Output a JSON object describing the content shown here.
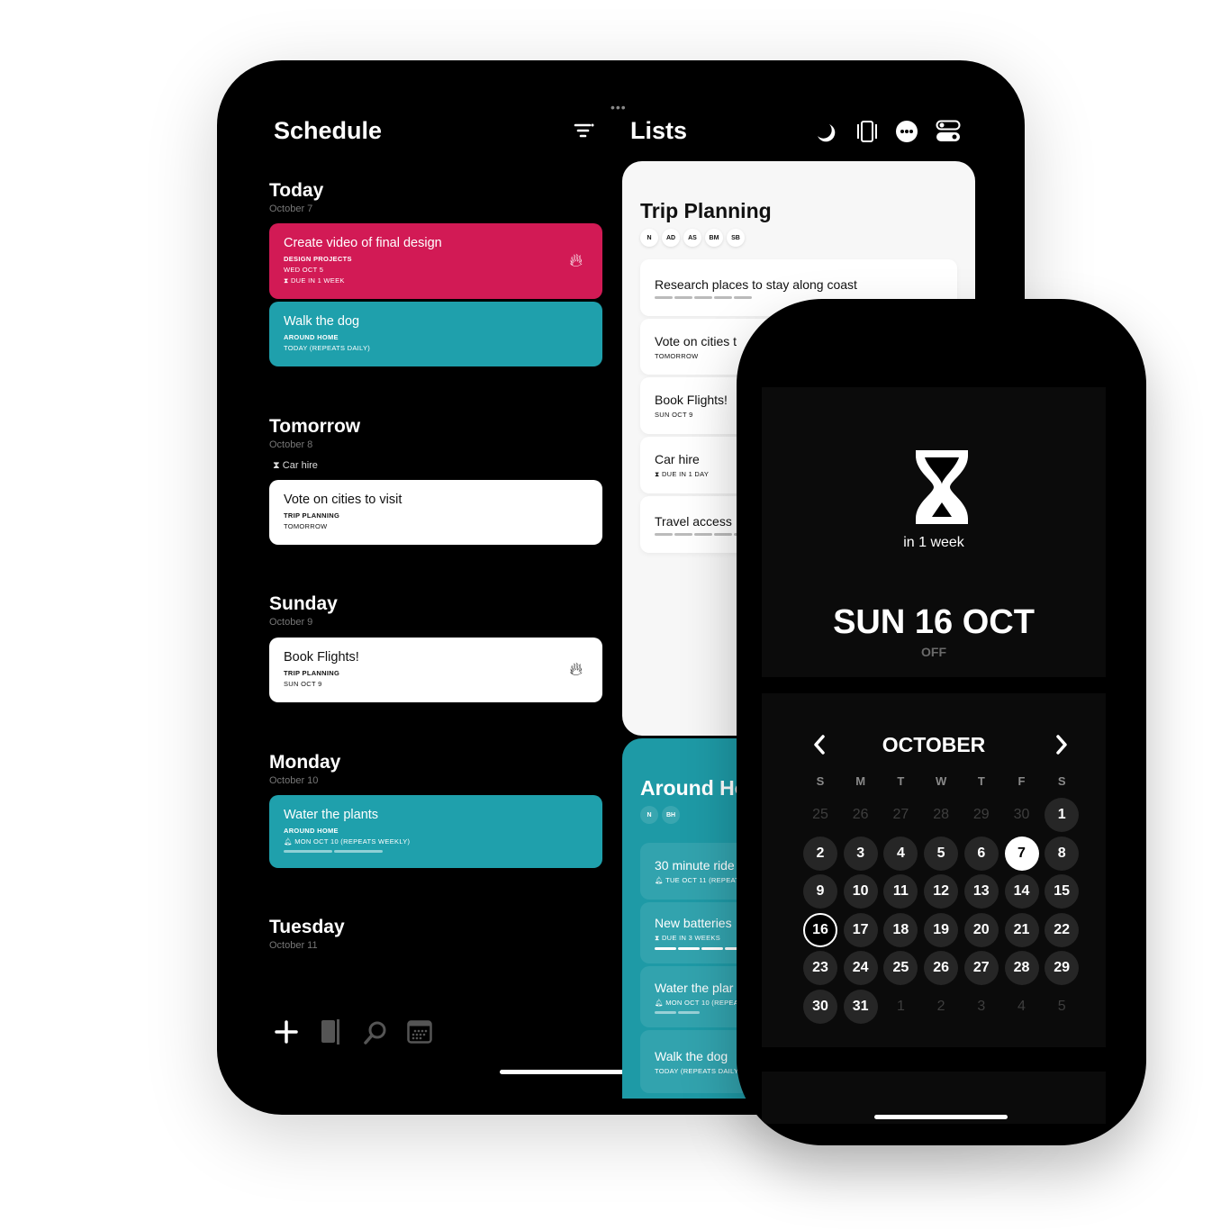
{
  "schedule": {
    "title": "Schedule",
    "days": [
      {
        "name": "Today",
        "date": "October 7"
      },
      {
        "name": "Tomorrow",
        "date": "October 8",
        "note": "Car hire"
      },
      {
        "name": "Sunday",
        "date": "October 9"
      },
      {
        "name": "Monday",
        "date": "October 10"
      },
      {
        "name": "Tuesday",
        "date": "October 11"
      }
    ],
    "tasks": [
      {
        "title": "Create video of final design",
        "list": "DESIGN PROJECTS",
        "date": "WED OCT 5",
        "due": "DUE IN 1 WEEK",
        "color": "#d21a55"
      },
      {
        "title": "Walk the dog",
        "list": "AROUND HOME",
        "date": "TODAY (REPEATS DAILY)",
        "color": "#1fa0ac"
      },
      {
        "title": "Vote on cities to visit",
        "list": "TRIP PLANNING",
        "date": "TOMORROW"
      },
      {
        "title": "Book Flights!",
        "list": "TRIP PLANNING",
        "date": "SUN OCT 9"
      },
      {
        "title": "Water the plants",
        "list": "AROUND HOME",
        "date": "MON OCT 10 (REPEATS WEEKLY)",
        "color": "#1fa0ac"
      }
    ]
  },
  "lists": {
    "title": "Lists",
    "trip": {
      "title": "Trip Planning",
      "members": [
        "N",
        "AD",
        "AS",
        "BM",
        "SB"
      ],
      "items": [
        {
          "title": "Research places to stay along coast",
          "meta": ""
        },
        {
          "title": "Vote on cities t",
          "meta": "TOMORROW"
        },
        {
          "title": "Book Flights!",
          "meta": "SUN OCT 9"
        },
        {
          "title": "Car hire",
          "meta": "DUE IN 1 DAY"
        },
        {
          "title": "Travel access",
          "meta": ""
        }
      ]
    },
    "around": {
      "title": "Around Ho",
      "members": [
        "N",
        "BH"
      ],
      "items": [
        {
          "title": "30 minute ride",
          "meta": "TUE OCT 11 (REPEAT"
        },
        {
          "title": "New batteries",
          "meta": "DUE IN 3 WEEKS"
        },
        {
          "title": "Water the plar",
          "meta": "MON OCT 10 (REPEA"
        },
        {
          "title": "Walk the dog",
          "meta": "TODAY (REPEATS DAILY"
        }
      ]
    }
  },
  "phone": {
    "countdown": "in 1 week",
    "date": "SUN 16 OCT",
    "status": "OFF",
    "month": "OCTOBER",
    "weekdays": [
      "S",
      "M",
      "T",
      "W",
      "T",
      "F",
      "S"
    ],
    "weeks": [
      [
        25,
        26,
        27,
        28,
        29,
        30,
        1
      ],
      [
        2,
        3,
        4,
        5,
        6,
        7,
        8
      ],
      [
        9,
        10,
        11,
        12,
        13,
        14,
        15
      ],
      [
        16,
        17,
        18,
        19,
        20,
        21,
        22
      ],
      [
        23,
        24,
        25,
        26,
        27,
        28,
        29
      ],
      [
        30,
        31,
        1,
        2,
        3,
        4,
        5
      ]
    ],
    "today": 7,
    "selected": 16
  },
  "colors": {
    "pink": "#d21a55",
    "teal": "#1fa0ac",
    "panel": "#0b0b0b"
  }
}
